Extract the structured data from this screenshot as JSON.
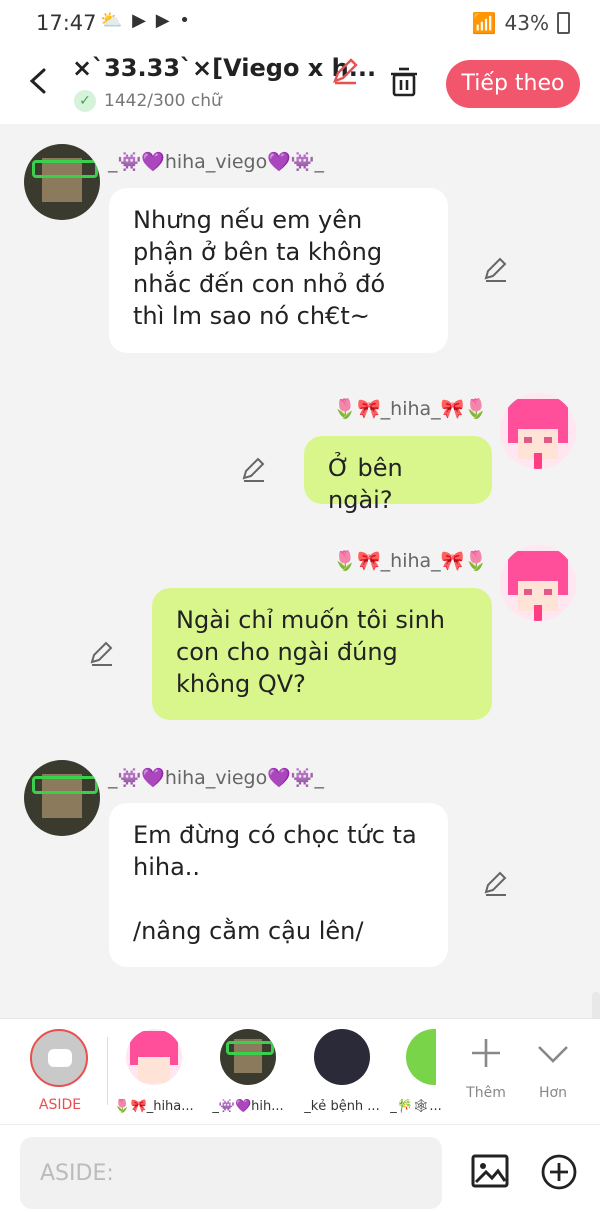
{
  "status": {
    "time": "17:47",
    "icons": "⛅ ▶ ▶ •",
    "battery": "43%"
  },
  "header": {
    "title": "×`33.33`×[Viego x h...",
    "word_count": "1442/300 chữ",
    "next_label": "Tiếp theo"
  },
  "messages": [
    {
      "side": "left",
      "author": "_👾💜hiha_viego💜👾_",
      "avatar": "viego",
      "text": "Nhưng nếu em yên phận ở bên ta không nhắc đến con nhỏ đó thì lm sao nó ch€t~"
    },
    {
      "side": "right",
      "author": "🌷🎀_hiha_🎀🌷",
      "avatar": "hiha",
      "text": "Ở bên ngài?"
    },
    {
      "side": "right",
      "author": "🌷🎀_hiha_🎀🌷",
      "avatar": "hiha",
      "text": "Ngài chỉ muốn tôi sinh con cho ngài đúng không QV?"
    },
    {
      "side": "left",
      "author": "_👾💜hiha_viego💜👾_",
      "avatar": "viego",
      "text": "Em đừng có chọc tức ta hiha..\n\n/nâng cằm cậu lên/"
    }
  ],
  "characters": [
    {
      "label": "ASIDE",
      "avatar": "aside"
    },
    {
      "label": "🌷🎀_hiha...",
      "avatar": "hiha"
    },
    {
      "label": "_👾💜hih...",
      "avatar": "viego"
    },
    {
      "label": "_kẻ bệnh ...",
      "avatar": "dark"
    },
    {
      "label": "_🎋🕸...",
      "avatar": "green"
    }
  ],
  "more_label": "Thêm",
  "collapse_label": "Hơn",
  "input": {
    "placeholder": "ASIDE:"
  },
  "icons": [
    "back-icon",
    "edit-title-icon",
    "trash-icon",
    "check-icon",
    "pencil-icon",
    "image-icon",
    "plus-circle-icon",
    "plus-icon",
    "chevron-down-icon"
  ]
}
